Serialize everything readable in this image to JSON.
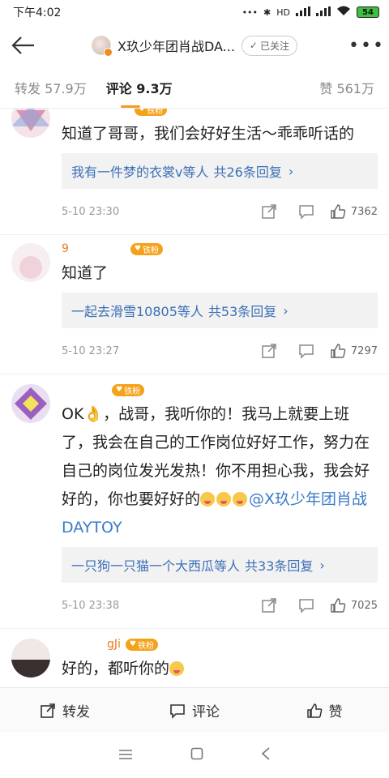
{
  "status": {
    "time": "下午4:02",
    "network": "HD",
    "battery": "54"
  },
  "nav": {
    "title": "X玖少年团肖战DA...",
    "follow_label": "已关注"
  },
  "tabs": {
    "repost": "转发 57.9万",
    "comment": "评论 9.3万",
    "like": "赞 561万"
  },
  "comments": [
    {
      "name": "      ",
      "badge": "铁粉",
      "text": "知道了哥哥，我们会好好生活～乖乖听话的",
      "reply_users": "我有一件梦的衣裳v等人",
      "reply_count": "共26条回复",
      "time": "5-10 23:30",
      "likes": "7362"
    },
    {
      "name": "9     ",
      "badge": "铁粉",
      "text": "知道了",
      "reply_users": "一起去滑雪10805等人",
      "reply_count": "共53条回复",
      "time": "5-10 23:27",
      "likes": "7297"
    },
    {
      "name": "    ",
      "badge": "铁粉",
      "text_part1": "OK",
      "text_part2": "，战哥，我听你的！我马上就要上班了，我会在自己的工作岗位好好工作，努力在自己的岗位发光发热！你不用担心我，我会好好的，你也要好好的",
      "mention": "@X玖少年团肖战DAYTOY",
      "reply_users": "一只狗一只猫一个大西瓜等人",
      "reply_count": "共33条回复",
      "time": "5-10 23:38",
      "likes": "7025"
    },
    {
      "name": "    gJi",
      "badge": "铁粉",
      "text": "好的，都听你的"
    }
  ],
  "bottom": {
    "repost": "转发",
    "comment": "评论",
    "like": "赞"
  },
  "colors": {
    "accent": "#f59a23",
    "link": "#3b6fb6",
    "name": "#e67a1f"
  }
}
